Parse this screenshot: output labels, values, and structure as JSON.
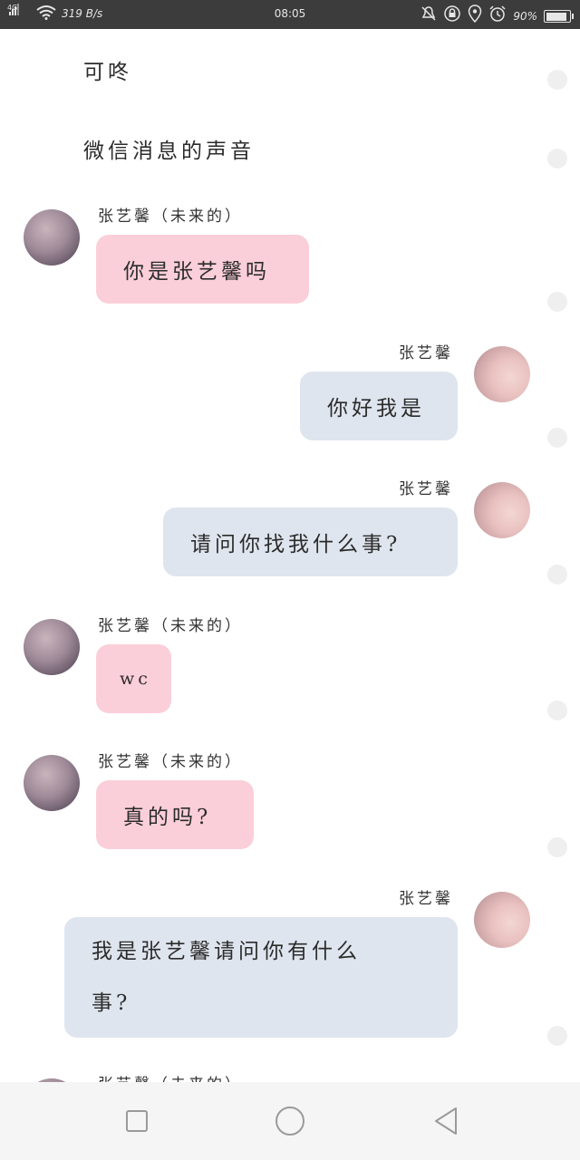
{
  "status_bar": {
    "network": "4G",
    "speed": "319 B/s",
    "time": "08:05",
    "battery_percent": "90%",
    "battery_level": 0.9,
    "icons": [
      "signal-icon",
      "wifi-icon",
      "mute-icon",
      "lock-rotation-icon",
      "location-icon",
      "alarm-icon",
      "battery-icon"
    ]
  },
  "chat": {
    "plain_messages": [
      "可咚",
      "微信消息的声音"
    ],
    "messages": [
      {
        "side": "left",
        "sender": "张艺馨（未来的）",
        "text": "你是张艺馨吗"
      },
      {
        "side": "right",
        "sender": "张艺馨",
        "text": "你好我是"
      },
      {
        "side": "right",
        "sender": "张艺馨",
        "text": "请问你找我什么事?"
      },
      {
        "side": "left",
        "sender": "张艺馨（未来的）",
        "text": "wc"
      },
      {
        "side": "left",
        "sender": "张艺馨（未来的）",
        "text": "真的吗?"
      },
      {
        "side": "right",
        "sender": "张艺馨",
        "text_line1": "我是张艺馨请问你有什么",
        "text_line2": "事?"
      },
      {
        "side": "left",
        "sender": "张艺馨（未来的）"
      }
    ]
  },
  "colors": {
    "pink_bubble": "#fbcfd9",
    "gray_bubble": "#dfe5ee",
    "status_bar_bg": "#3c3c3c",
    "nav_bar_bg": "#f5f5f5"
  },
  "nav_bar": {
    "buttons": [
      "recent-apps-icon",
      "home-icon",
      "back-icon"
    ]
  }
}
